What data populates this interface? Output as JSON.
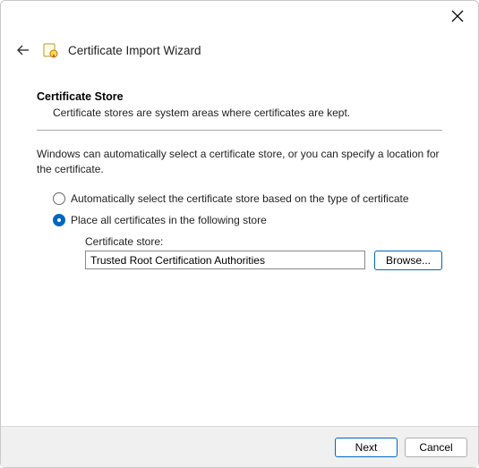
{
  "header": {
    "title": "Certificate Import Wizard"
  },
  "section": {
    "title": "Certificate Store",
    "desc": "Certificate stores are system areas where certificates are kept."
  },
  "body_text": "Windows can automatically select a certificate store, or you can specify a location for the certificate.",
  "radio": {
    "auto": "Automatically select the certificate store based on the type of certificate",
    "place": "Place all certificates in the following store"
  },
  "store": {
    "label": "Certificate store:",
    "value": "Trusted Root Certification Authorities",
    "browse": "Browse..."
  },
  "footer": {
    "next": "Next",
    "cancel": "Cancel"
  }
}
